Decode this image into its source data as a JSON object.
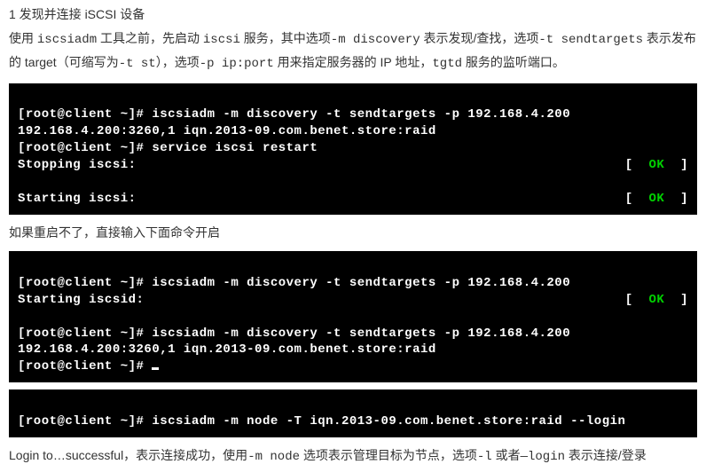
{
  "heading": "1 发现并连接 iSCSI 设备",
  "para1": {
    "t1": "使用 ",
    "t2": "iscsiadm",
    "t3": " 工具之前，先启动 ",
    "t4": "iscsi",
    "t5": " 服务，其中选项",
    "t6": "-m discovery",
    "t7": " 表示发现/查找，选项",
    "t8": "-t sendtargets",
    "t9": " 表示发布的 target（可缩写为",
    "t10": "-t st",
    "t11": "），选项",
    "t12": "-p ip:port",
    "t13": " 用来指定服务器的 IP 地址，",
    "t14": "tgtd",
    "t15": " 服务的监听端口。"
  },
  "term1": {
    "line1": "[root@client ~]# iscsiadm -m discovery -t sendtargets -p 192.168.4.200",
    "line2": "192.168.4.200:3260,1 iqn.2013-09.com.benet.store:raid",
    "line3": "[root@client ~]# service iscsi restart",
    "line4_left": "Stopping iscsi:",
    "line4_right_l": "[  ",
    "line4_right_ok": "OK",
    "line4_right_r": "  ]",
    "line5_left": "Starting iscsi:",
    "line5_right_l": "[  ",
    "line5_right_ok": "OK",
    "line5_right_r": "  ]"
  },
  "para2": "如果重启不了，直接输入下面命令开启",
  "term2": {
    "line1": "[root@client ~]# iscsiadm -m discovery -t sendtargets -p 192.168.4.200",
    "line2_left": "Starting iscsid:",
    "line2_right_l": "[  ",
    "line2_right_ok": "OK",
    "line2_right_r": "  ]",
    "line3": "[root@client ~]# iscsiadm -m discovery -t sendtargets -p 192.168.4.200",
    "line4": "192.168.4.200:3260,1 iqn.2013-09.com.benet.store:raid",
    "line5": "[root@client ~]# "
  },
  "term3": {
    "line1": "[root@client ~]# iscsiadm -m node -T iqn.2013-09.com.benet.store:raid --login"
  },
  "para3": {
    "t1": "Login to…successful，表示连接成功，使用",
    "t2": "-m node",
    "t3": " 选项表示管理目标为节点，选项",
    "t4": "-l",
    "t5": " 或者",
    "t6": "—login",
    "t7": " 表示连接/登录"
  }
}
